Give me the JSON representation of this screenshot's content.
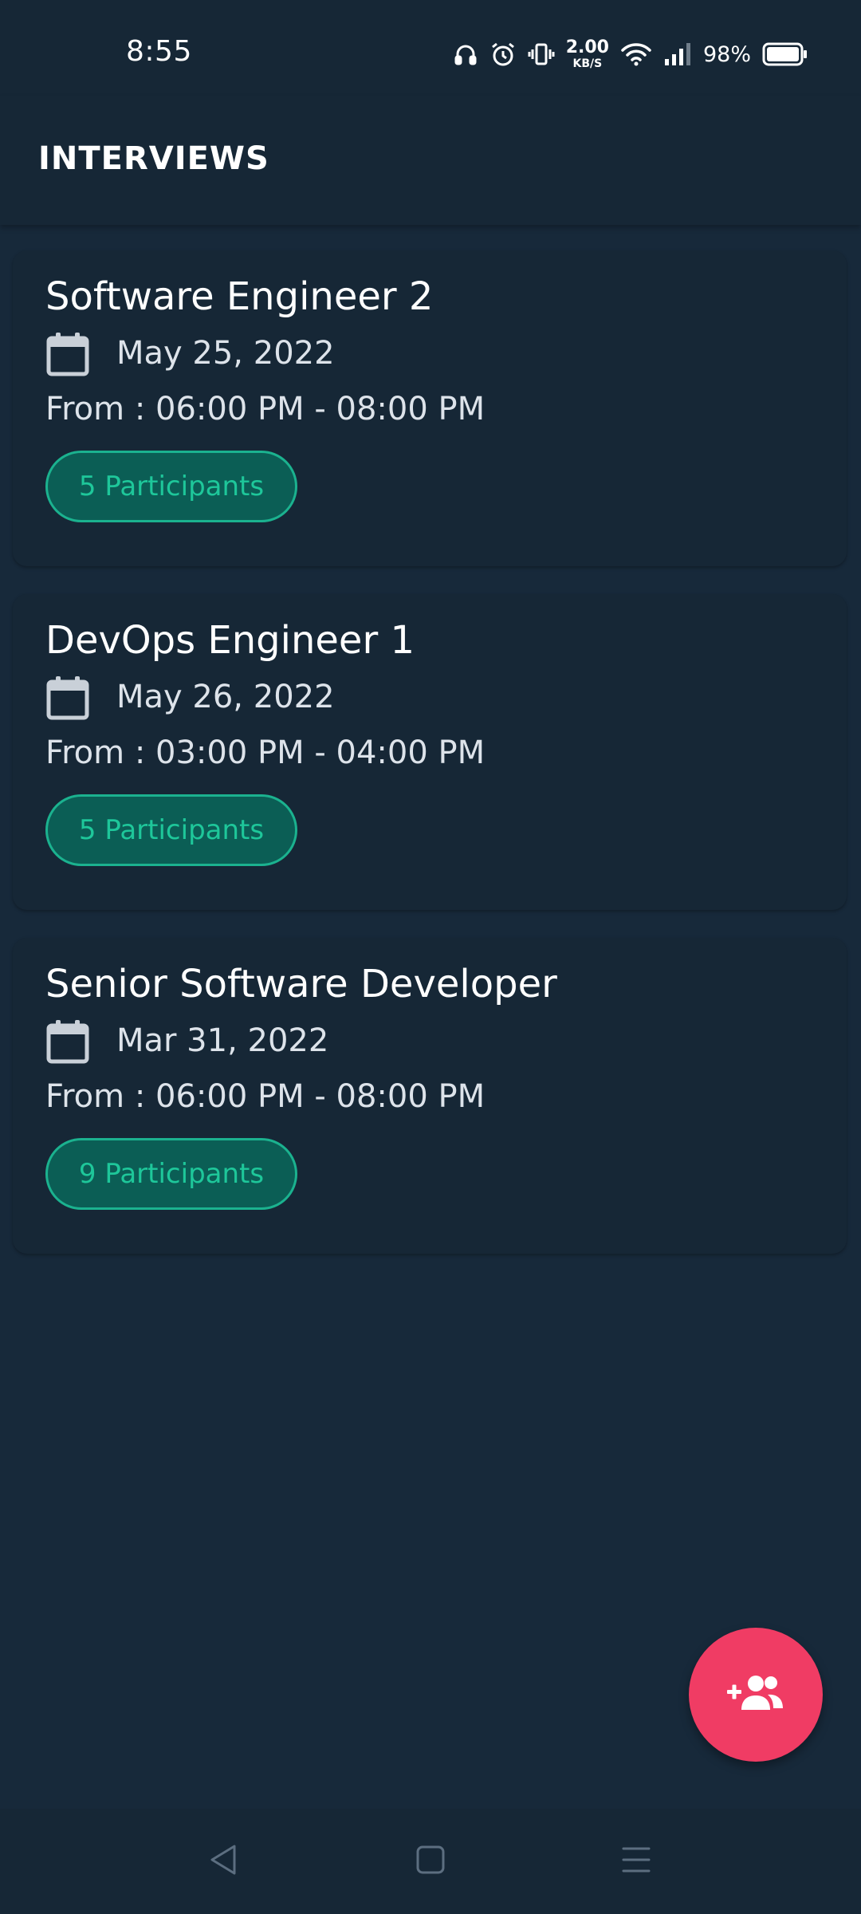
{
  "status_bar": {
    "time": "8:55",
    "net_speed_value": "2.00",
    "net_speed_unit": "KB/S",
    "battery_percent": "98%",
    "icons": [
      "headphones-icon",
      "alarm-icon",
      "vibrate-icon",
      "wifi-icon",
      "signal-icon",
      "battery-icon"
    ]
  },
  "app_bar": {
    "title": "INTERVIEWS"
  },
  "interviews": [
    {
      "title": "Software Engineer 2",
      "date": "May 25, 2022",
      "time_range": "From : 06:00 PM - 08:00 PM",
      "participants": "5 Participants"
    },
    {
      "title": "DevOps Engineer 1",
      "date": "May 26, 2022",
      "time_range": "From : 03:00 PM - 04:00 PM",
      "participants": "5 Participants"
    },
    {
      "title": "Senior Software Developer",
      "date": "Mar 31, 2022",
      "time_range": "From : 06:00 PM - 08:00 PM",
      "participants": "9 Participants"
    }
  ],
  "fab": {
    "icon": "add-group-icon"
  },
  "nav_bar": {
    "icons": [
      "back-icon",
      "home-icon",
      "recents-icon"
    ]
  },
  "colors": {
    "background": "#17293a",
    "surface": "#162736",
    "chip_fill": "#0b5e55",
    "chip_accent": "#1ec79a",
    "fab": "#f03c64"
  }
}
